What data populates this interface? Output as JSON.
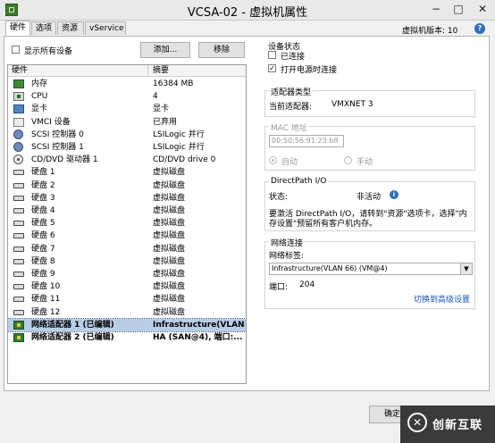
{
  "window": {
    "title": "VCSA-02 - 虚拟机属性",
    "minimize_glyph": "−",
    "maximize_glyph": "□",
    "close_glyph": "✕"
  },
  "tabs": [
    {
      "label": "硬件",
      "active": true
    },
    {
      "label": "选项",
      "active": false
    },
    {
      "label": "资源",
      "active": false
    },
    {
      "label": "vService",
      "active": false
    }
  ],
  "vm_version": "虚拟机版本: 10",
  "help_glyph": "?",
  "hardware": {
    "show_all_devices_label": "显示所有设备",
    "show_all_devices_checked": false,
    "add_button": "添加...",
    "remove_button": "移除",
    "col_hardware": "硬件",
    "col_summary": "摘要",
    "rows": [
      {
        "icon": "memory-icon",
        "name": "内存",
        "summary": "16384 MB"
      },
      {
        "icon": "cpu-icon",
        "name": "CPU",
        "summary": "4"
      },
      {
        "icon": "display-icon",
        "name": "显卡",
        "summary": "显卡"
      },
      {
        "icon": "vmci-icon",
        "name": "VMCI 设备",
        "summary": "已弃用"
      },
      {
        "icon": "scsi-icon",
        "name": "SCSI 控制器 0",
        "summary": "LSILogic 并行"
      },
      {
        "icon": "scsi-icon",
        "name": "SCSI 控制器 1",
        "summary": "LSILogic 并行"
      },
      {
        "icon": "cd-icon",
        "name": "CD/DVD 驱动器 1",
        "summary": "CD/DVD drive 0"
      },
      {
        "icon": "disk-icon",
        "name": "硬盘 1",
        "summary": "虚拟磁盘"
      },
      {
        "icon": "disk-icon",
        "name": "硬盘 2",
        "summary": "虚拟磁盘"
      },
      {
        "icon": "disk-icon",
        "name": "硬盘 3",
        "summary": "虚拟磁盘"
      },
      {
        "icon": "disk-icon",
        "name": "硬盘 4",
        "summary": "虚拟磁盘"
      },
      {
        "icon": "disk-icon",
        "name": "硬盘 5",
        "summary": "虚拟磁盘"
      },
      {
        "icon": "disk-icon",
        "name": "硬盘 6",
        "summary": "虚拟磁盘"
      },
      {
        "icon": "disk-icon",
        "name": "硬盘 7",
        "summary": "虚拟磁盘"
      },
      {
        "icon": "disk-icon",
        "name": "硬盘 8",
        "summary": "虚拟磁盘"
      },
      {
        "icon": "disk-icon",
        "name": "硬盘 9",
        "summary": "虚拟磁盘"
      },
      {
        "icon": "disk-icon",
        "name": "硬盘 10",
        "summary": "虚拟磁盘"
      },
      {
        "icon": "disk-icon",
        "name": "硬盘 11",
        "summary": "虚拟磁盘"
      },
      {
        "icon": "disk-icon",
        "name": "硬盘 12",
        "summary": "虚拟磁盘"
      },
      {
        "icon": "nic-icon",
        "name": "网络适配器 1 (已编辑)",
        "summary": "Infrastructure(VLAN...",
        "selected": true,
        "bold": true
      },
      {
        "icon": "nic-icon",
        "name": "网络适配器 2 (已编辑)",
        "summary": "HA (SAN@4), 端口:...",
        "bold": true
      }
    ]
  },
  "device_status": {
    "title": "设备状态",
    "connected_label": "已连接",
    "connected_checked": false,
    "connect_at_power_on_label": "打开电源时连接",
    "connect_at_power_on_checked": true,
    "check_glyph": "✓"
  },
  "adapter_type": {
    "title": "适配器类型",
    "current_label": "当前适配器:",
    "current_value": "VMXNET 3"
  },
  "mac_address": {
    "title": "MAC 地址",
    "value": "00:50:56:91:23:b8",
    "auto_label": "自动",
    "manual_label": "手动",
    "auto_selected": true
  },
  "directpath": {
    "title": "DirectPath I/O",
    "status_label": "状态:",
    "status_value": "非活动",
    "info_glyph": "i",
    "note_line1": "要激活 DirectPath I/O，请转到\"资源\"选项卡，选择\"内",
    "note_line2": "存设置\"预留所有客户机内存。"
  },
  "network": {
    "title": "网络连接",
    "label_label": "网络标签:",
    "label_value": "Infrastructure(VLAN 66) (VM@4)",
    "dropdown_glyph": "▼",
    "port_label": "端口:",
    "port_value": "204",
    "advanced_link": "切换到高级设置"
  },
  "footer": {
    "ok_button": "确定",
    "watermark_glyph": "✕",
    "watermark_text": "创新互联"
  }
}
